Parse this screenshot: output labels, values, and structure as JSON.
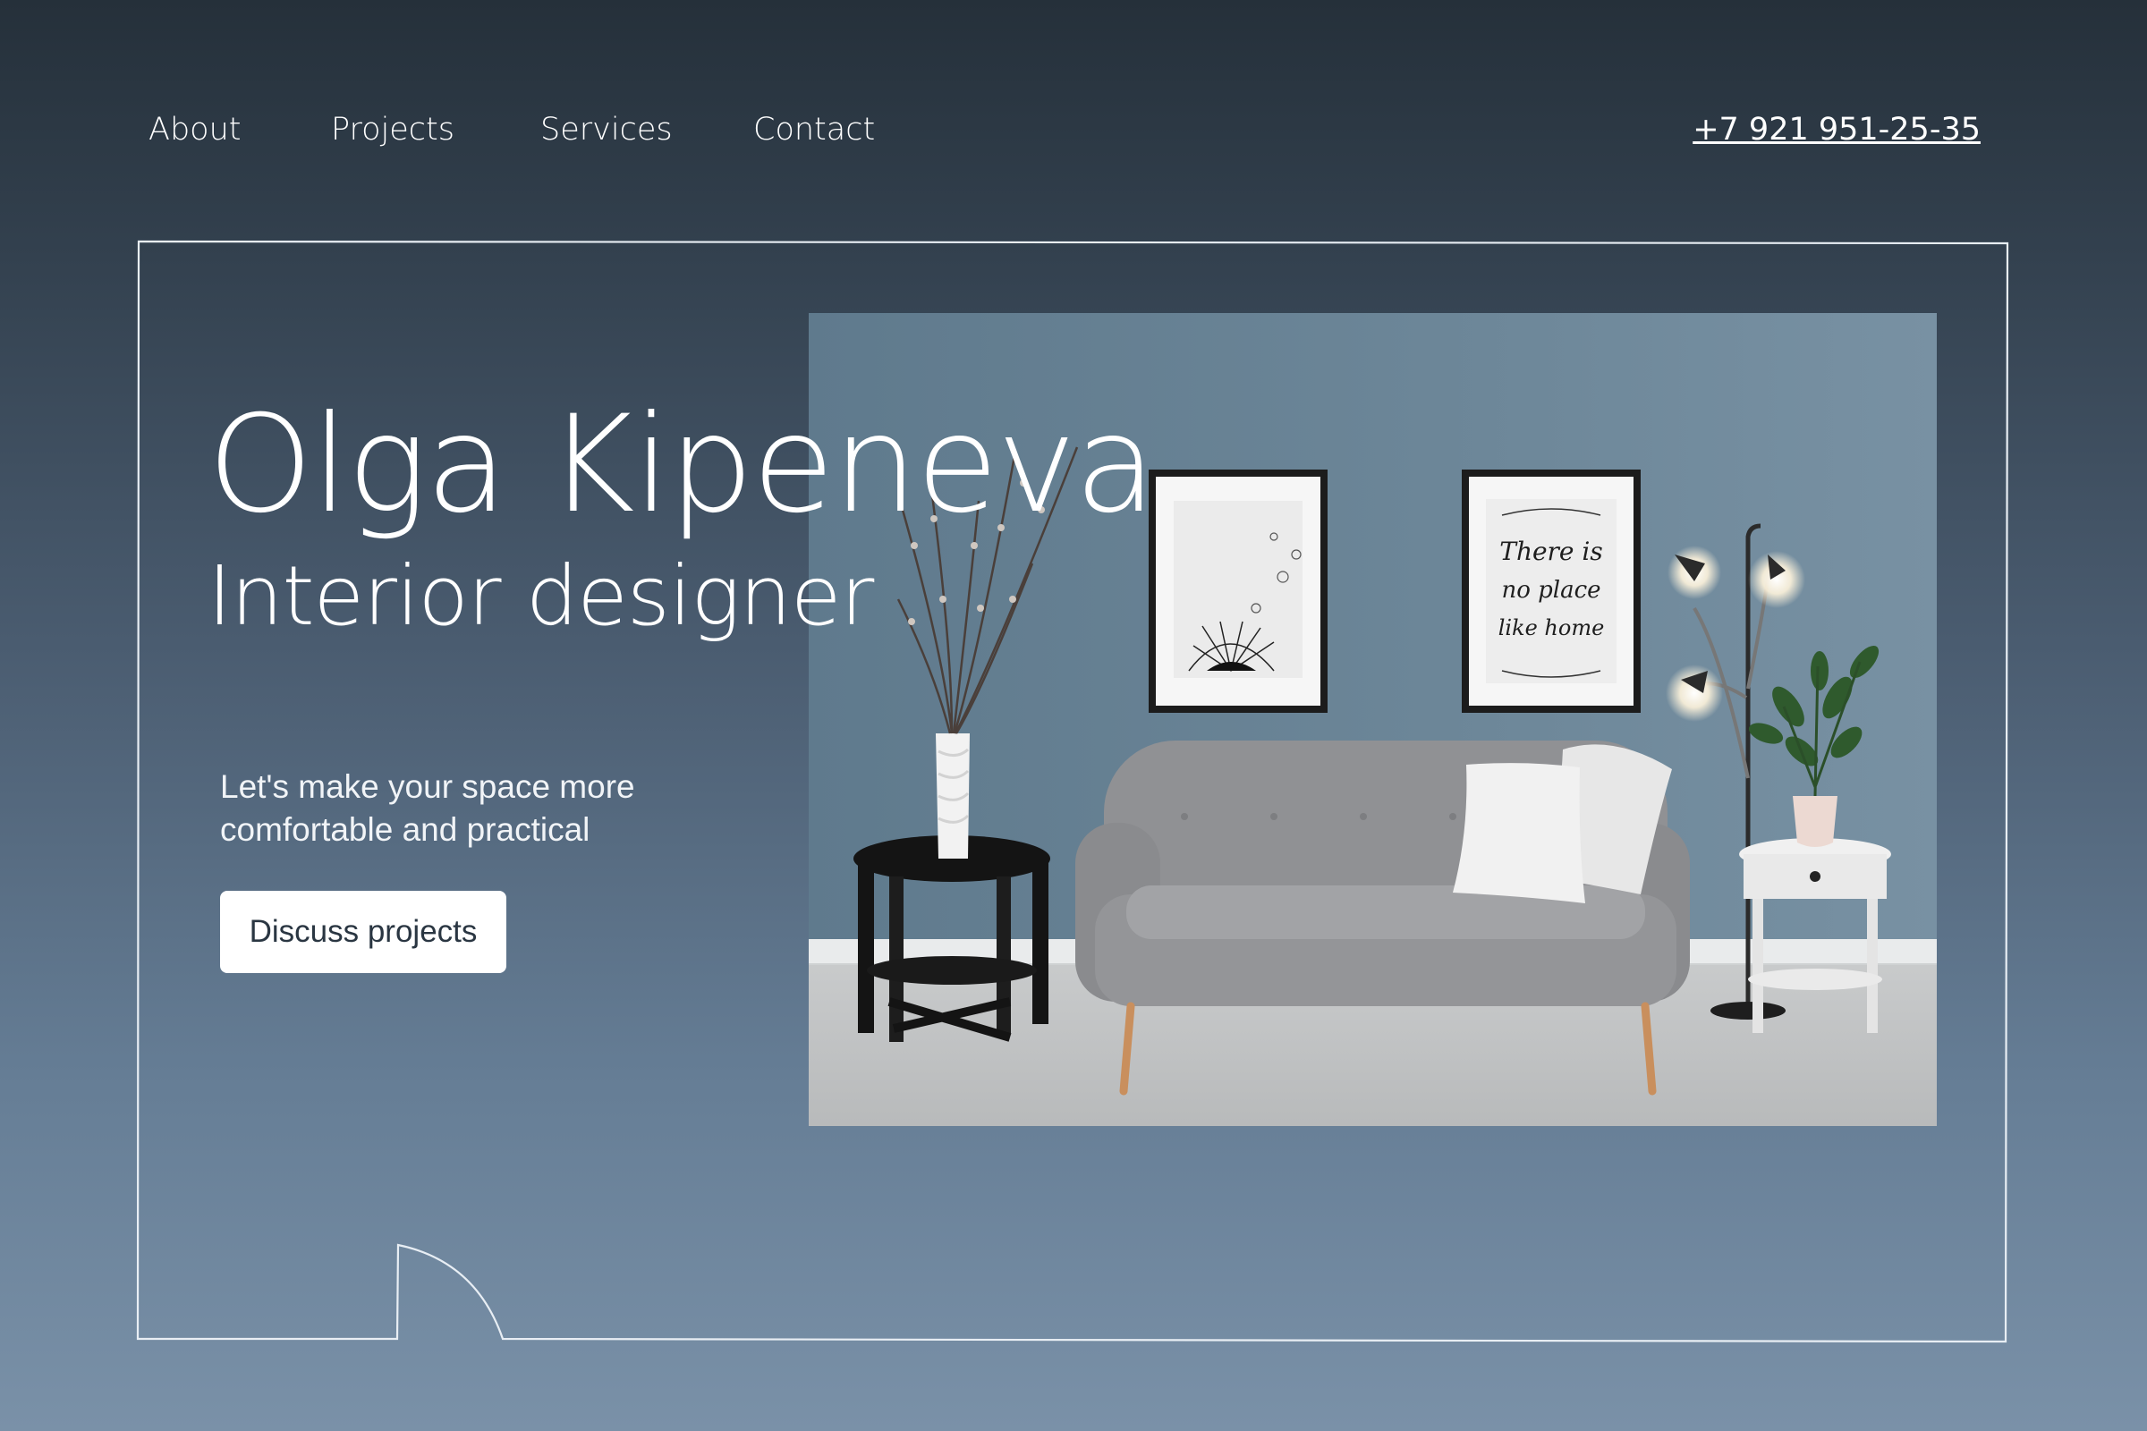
{
  "nav": {
    "items": [
      {
        "label": "About"
      },
      {
        "label": "Projects"
      },
      {
        "label": "Services"
      },
      {
        "label": "Contact"
      }
    ],
    "phone": "+7 921 951-25-35"
  },
  "hero": {
    "name": "Olga Kipeneva",
    "role": "Interior designer",
    "tagline": "Let's make your space more comfortable and practical",
    "cta_label": "Discuss projects",
    "poster_text": [
      "There is",
      "no place",
      "like home"
    ]
  },
  "colors": {
    "background_top": "#25303a",
    "background_bottom": "#7a91a8",
    "wall": "#6c8597",
    "accent_text": "#ffffff",
    "button_text": "#2a3642"
  }
}
